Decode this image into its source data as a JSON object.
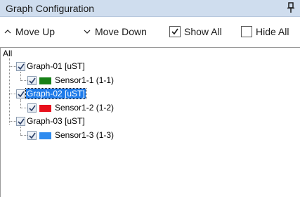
{
  "panel": {
    "title": "Graph Configuration"
  },
  "toolbar": {
    "move_up": "Move Up",
    "move_down": "Move Down",
    "show_all": "Show All",
    "hide_all": "Hide All",
    "show_all_checked": true,
    "hide_all_checked": false
  },
  "tree": {
    "root": "All",
    "graphs": [
      {
        "label": "Graph-01 [uST]",
        "checked": true,
        "selected": false,
        "sensor": {
          "label": "Sensor1-1 (1-1)",
          "checked": true,
          "color": "#178017"
        }
      },
      {
        "label": "Graph-02 [uST]",
        "checked": true,
        "selected": true,
        "sensor": {
          "label": "Sensor1-2 (1-2)",
          "checked": true,
          "color": "#e8101c"
        }
      },
      {
        "label": "Graph-03 [uST]",
        "checked": true,
        "selected": false,
        "sensor": {
          "label": "Sensor1-3 (1-3)",
          "checked": true,
          "color": "#2e8bef"
        }
      }
    ]
  },
  "colors": {
    "titlebar": "#cfddee",
    "selection": "#1e7bea"
  }
}
